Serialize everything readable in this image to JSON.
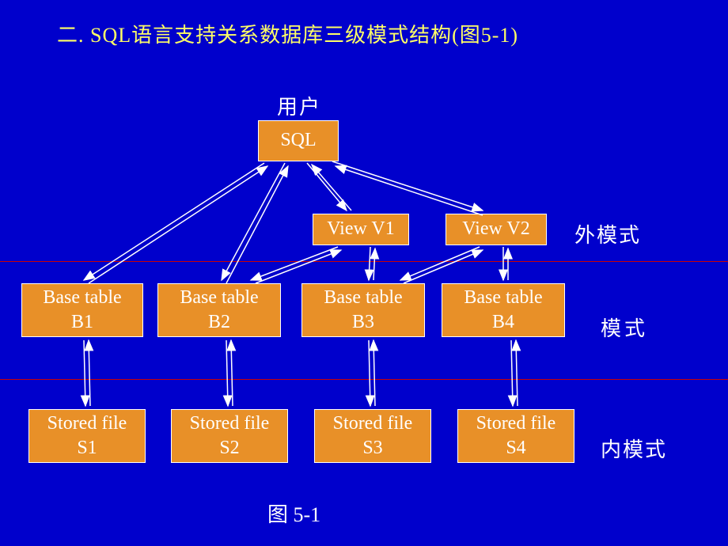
{
  "title": "二.   SQL语言支持关系数据库三级模式结构(图5-1)",
  "labels": {
    "user": "用户",
    "external_schema": "外模式",
    "schema": "模式",
    "internal_schema": "内模式"
  },
  "caption": "图 5-1",
  "boxes": {
    "sql": "SQL",
    "view1": "View  V1",
    "view2": "View  V2",
    "base1_l1": "Base   table",
    "base1_l2": "B1",
    "base2_l1": "Base   table",
    "base2_l2": "B2",
    "base3_l1": "Base   table",
    "base3_l2": "B3",
    "base4_l1": "Base   table",
    "base4_l2": "B4",
    "file1_l1": "Stored  file",
    "file1_l2": "S1",
    "file2_l1": "Stored  file",
    "file2_l2": "S2",
    "file3_l1": "Stored  file",
    "file3_l2": "S3",
    "file4_l1": "Stored  file",
    "file4_l2": "S4"
  }
}
